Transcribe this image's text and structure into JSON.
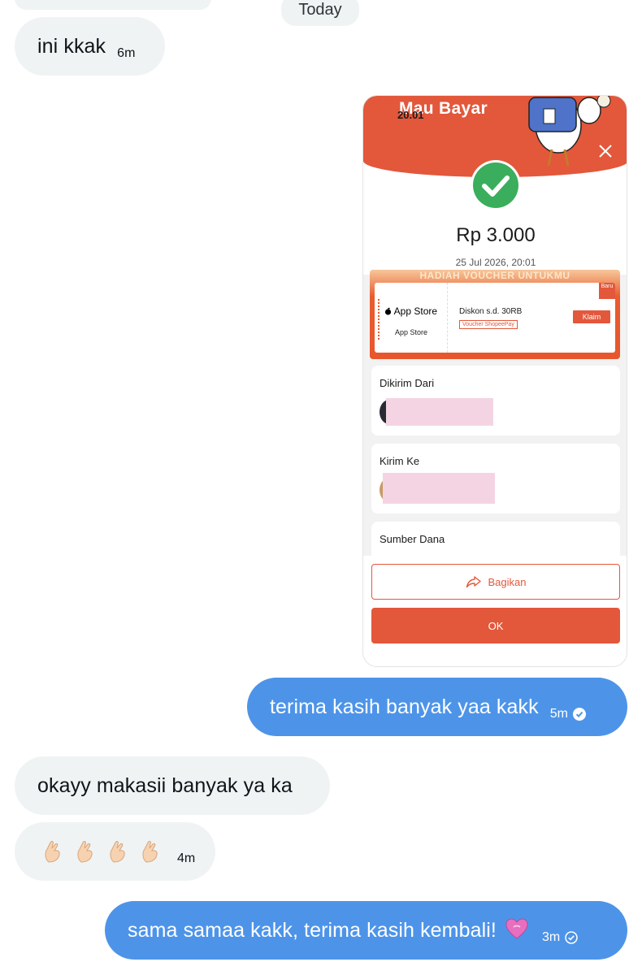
{
  "day_divider": "Today",
  "messages": [
    {
      "text": "ini kkak",
      "time": "6m"
    },
    {
      "text": "terima kasih banyak yaa kakk",
      "time": "5m"
    },
    {
      "text": "okayy makasii banyak ya ka"
    },
    {
      "time": "4m"
    },
    {
      "text": "sama samaa kakk, terima kasih kembali!",
      "time": "3m"
    }
  ],
  "attachment": {
    "status_time": "20.01",
    "header_title": "Mau Bayar",
    "amount": "Rp 3.000",
    "date": "25 Jul 2026, 20:01",
    "voucher": {
      "banner": "HADIAH VOUCHER UNTUKMU",
      "store_logo": "App Store",
      "store_name": "App Store",
      "title": "Diskon s.d. 30RB",
      "tag": "Voucher ShopeePay",
      "claim_label": "Klaim",
      "corner_label": "Baru"
    },
    "sections": [
      "Dikirim Dari",
      "Kirim Ke",
      "Sumber Dana"
    ],
    "share_label": "Bagikan",
    "ok_label": "OK"
  },
  "colors": {
    "incoming_bubble": "#eff3f4",
    "outgoing_bubble": "#4d94e9",
    "shopee_orange": "#e3573b",
    "success_green": "#3aae5c",
    "redaction_pink": "#f4d4e3"
  },
  "icons": [
    "close-icon",
    "check-circle-icon",
    "share-icon",
    "read-check-icon",
    "pinched-fingers-icon",
    "heart-icon",
    "apple-icon"
  ]
}
